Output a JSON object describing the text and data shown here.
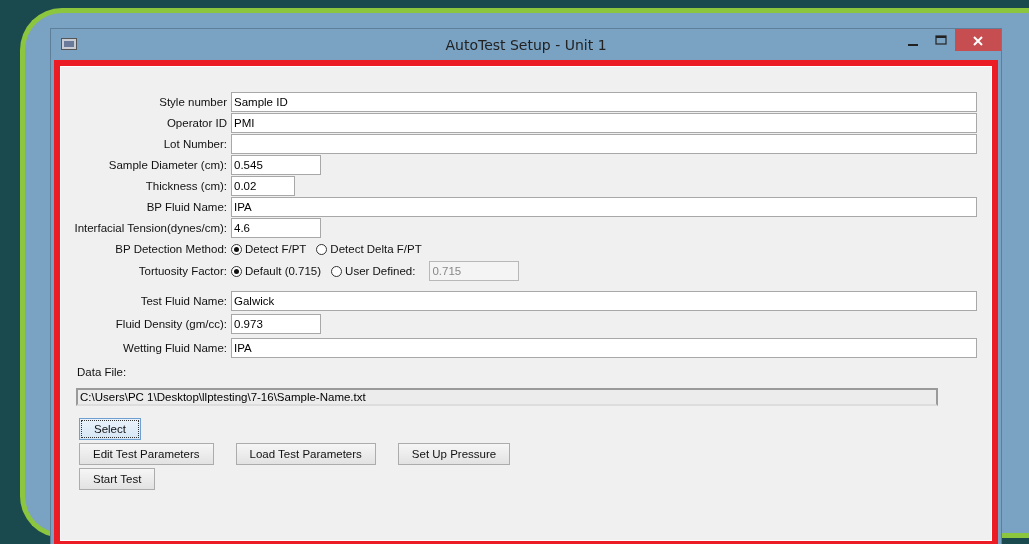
{
  "window": {
    "title": "AutoTest Setup - Unit 1"
  },
  "fields": [
    {
      "kind": "wide",
      "label": "Style number",
      "value": "Sample ID"
    },
    {
      "kind": "wide",
      "label": "Operator ID",
      "value": "PMI"
    },
    {
      "kind": "wide",
      "label": "Lot Number:"
    },
    {
      "kind": "short",
      "label": "Sample Diameter (cm):",
      "value": "0.545"
    },
    {
      "kind": "tiny",
      "label": "Thickness (cm):",
      "value": "0.02"
    },
    {
      "kind": "wide",
      "label": "BP Fluid Name:",
      "value": "IPA"
    },
    {
      "kind": "short",
      "label": "Interfacial Tension(dynes/cm):",
      "value": "4.6"
    },
    {
      "kind": "radio",
      "label": "BP Detection Method:",
      "options": [
        {
          "label": "Detect F/PT",
          "selected": true
        },
        {
          "label": "Detect Delta F/PT",
          "selected": false
        }
      ]
    },
    {
      "kind": "radio",
      "label": "Tortuosity Factor:",
      "options": [
        {
          "label": "Default (0.715)",
          "selected": true
        },
        {
          "label": "User Defined:",
          "selected": false
        }
      ],
      "extra": {
        "value": "0.715",
        "disabled": true
      }
    },
    {
      "kind": "wide",
      "label": "Test Fluid Name:",
      "value": "Galwick"
    },
    {
      "kind": "short",
      "label": "Fluid Density (gm/cc):",
      "value": "0.973"
    },
    {
      "kind": "wide",
      "label": "Wetting Fluid Name:",
      "value": "IPA"
    }
  ],
  "data_file": {
    "label": "Data File:",
    "path": "C:\\Users\\PC 1\\Desktop\\llptesting\\7-16\\Sample-Name.txt"
  },
  "button_rows": [
    [
      {
        "label": "Select",
        "focused": true
      }
    ],
    [
      {
        "label": "Edit Test Parameters",
        "focused": false
      },
      {
        "label": "Load Test Parameters",
        "focused": false
      },
      {
        "label": "Set Up Pressure",
        "focused": false
      }
    ],
    [
      {
        "label": "Start Test",
        "focused": false
      }
    ]
  ]
}
